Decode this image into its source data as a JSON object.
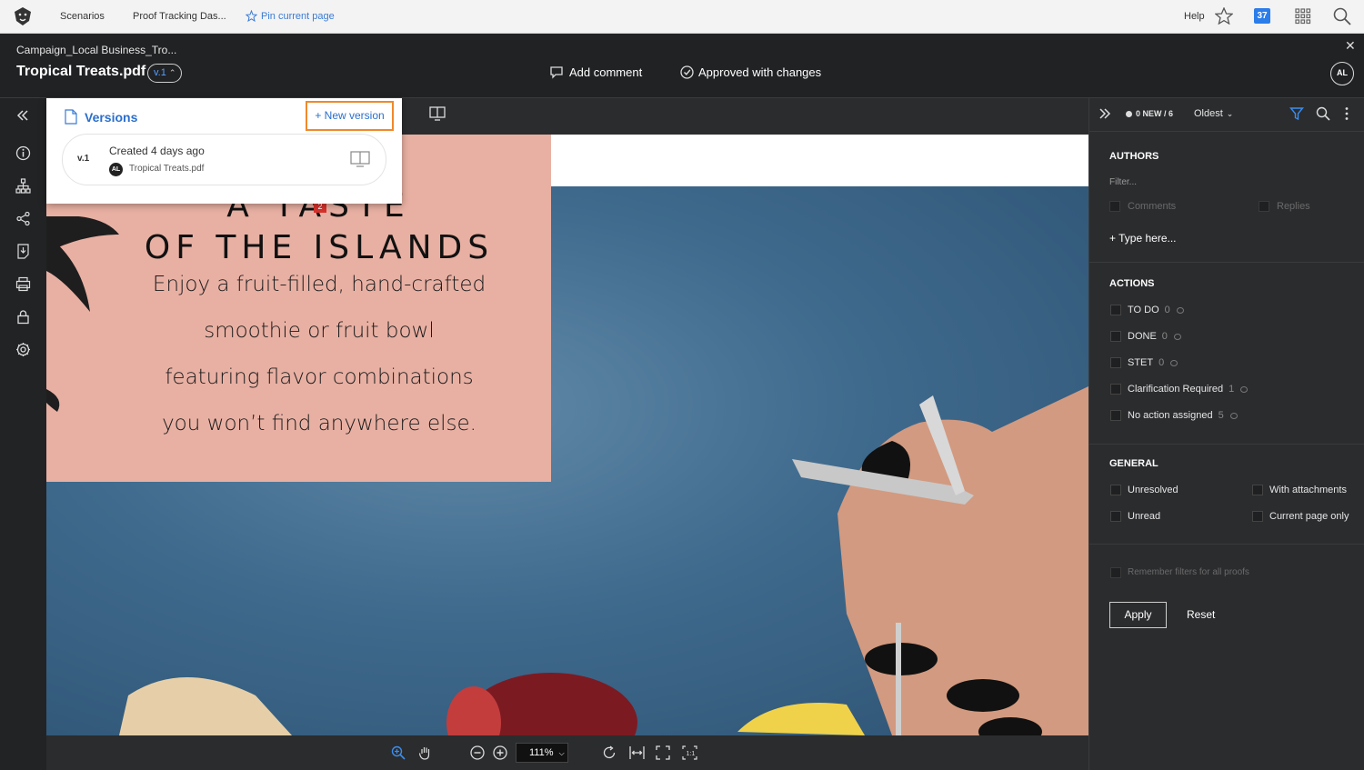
{
  "topnav": {
    "items": [
      "Scenarios",
      "Proof Tracking Das..."
    ],
    "pin_label": "Pin current page",
    "help": "Help",
    "badge": "37"
  },
  "header": {
    "breadcrumb": "Campaign_Local Business_Tro...",
    "title": "Tropical Treats.pdf",
    "version": "v.1",
    "add_comment": "Add comment",
    "approved": "Approved with changes",
    "avatar": "AL"
  },
  "versions": {
    "title": "Versions",
    "new_version": "+ New version",
    "items": [
      {
        "label": "v.1",
        "created": "Created 4 days ago",
        "avatar": "AL",
        "filename": "Tropical Treats.pdf"
      }
    ]
  },
  "document": {
    "headline_1": "A TASTE",
    "headline_2": "OF THE ISLANDS",
    "lines": [
      "Enjoy a fruit-filled, hand-crafted",
      "smoothie or fruit bowl",
      "featuring flavor combinations",
      "you won’t find anywhere else."
    ],
    "marker_count": "2"
  },
  "toolbar": {
    "zoom": "111%"
  },
  "panel": {
    "new_count": "0 NEW / 6",
    "sort": "Oldest",
    "authors": {
      "title": "AUTHORS",
      "filter_placeholder": "Filter...",
      "comments": "Comments",
      "replies": "Replies",
      "type_here": "+ Type here..."
    },
    "actions": {
      "title": "ACTIONS",
      "items": [
        {
          "label": "TO DO",
          "count": "0"
        },
        {
          "label": "DONE",
          "count": "0"
        },
        {
          "label": "STET",
          "count": "0"
        },
        {
          "label": "Clarification Required",
          "count": "1"
        },
        {
          "label": "No action assigned",
          "count": "5"
        }
      ]
    },
    "general": {
      "title": "GENERAL",
      "unresolved": "Unresolved",
      "with_attachments": "With attachments",
      "unread": "Unread",
      "current_page_only": "Current page only"
    },
    "remember": "Remember filters for all proofs",
    "apply": "Apply",
    "reset": "Reset"
  },
  "colors": {
    "accent": "#2b7de9",
    "highlight": "#f0892b",
    "pink_panel": "#e8b0a3"
  }
}
